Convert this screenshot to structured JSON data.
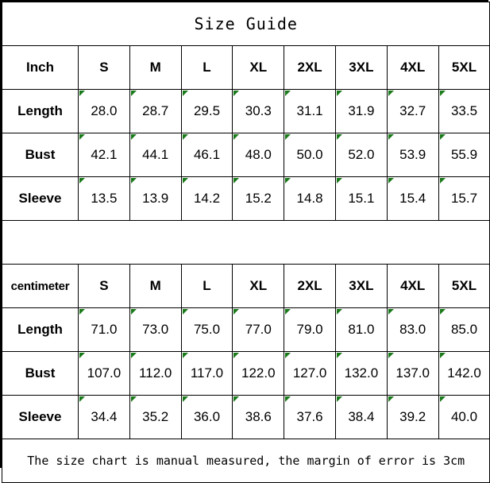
{
  "title": "Size Guide",
  "colors": {
    "border": "#000000",
    "background": "#ffffff",
    "text": "#000000",
    "corner_marker": "#1a7a1a"
  },
  "sizes": [
    "S",
    "M",
    "L",
    "XL",
    "2XL",
    "3XL",
    "4XL",
    "5XL"
  ],
  "tables": [
    {
      "unit_label": "Inch",
      "rows": [
        {
          "label": "Length",
          "values": [
            "28.0",
            "28.7",
            "29.5",
            "30.3",
            "31.1",
            "31.9",
            "32.7",
            "33.5"
          ]
        },
        {
          "label": "Bust",
          "values": [
            "42.1",
            "44.1",
            "46.1",
            "48.0",
            "50.0",
            "52.0",
            "53.9",
            "55.9"
          ]
        },
        {
          "label": "Sleeve",
          "values": [
            "13.5",
            "13.9",
            "14.2",
            "15.2",
            "14.8",
            "15.1",
            "15.4",
            "15.7"
          ]
        }
      ]
    },
    {
      "unit_label": "centimeter",
      "rows": [
        {
          "label": "Length",
          "values": [
            "71.0",
            "73.0",
            "75.0",
            "77.0",
            "79.0",
            "81.0",
            "83.0",
            "85.0"
          ]
        },
        {
          "label": "Bust",
          "values": [
            "107.0",
            "112.0",
            "117.0",
            "122.0",
            "127.0",
            "132.0",
            "137.0",
            "142.0"
          ]
        },
        {
          "label": "Sleeve",
          "values": [
            "34.4",
            "35.2",
            "36.0",
            "38.6",
            "37.6",
            "38.4",
            "39.2",
            "40.0"
          ]
        }
      ]
    }
  ],
  "footer_note": "The size chart is manual measured, the margin of error is 3cm"
}
